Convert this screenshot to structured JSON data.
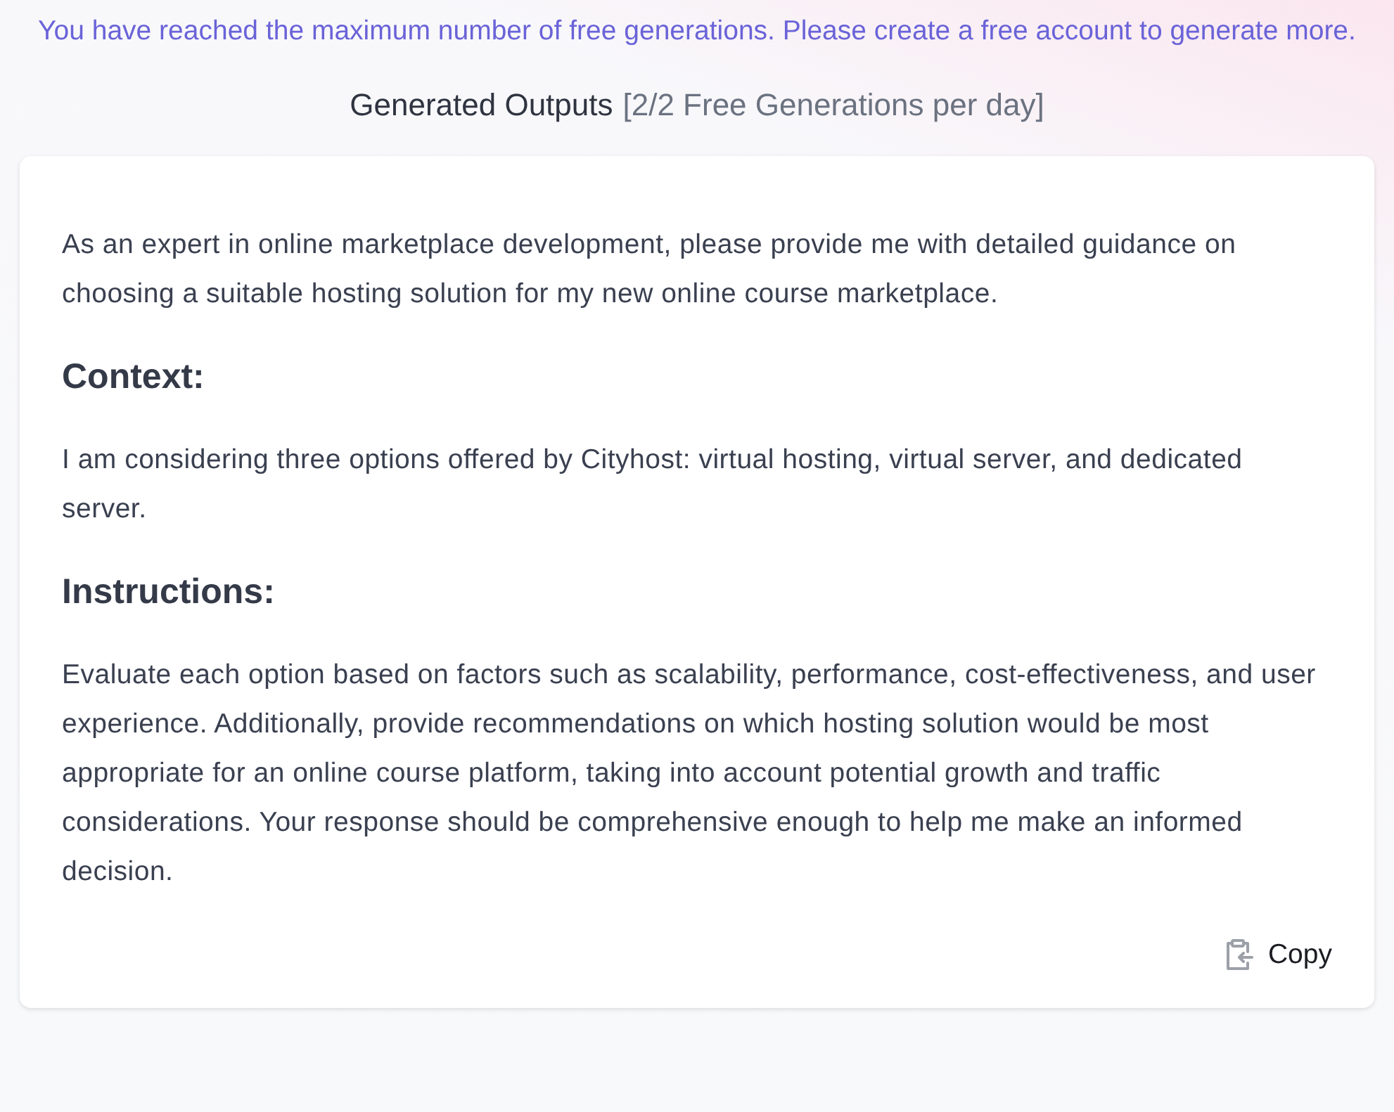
{
  "notice": "You have reached the maximum number of free generations. Please create a free account to generate more.",
  "header": {
    "title": "Generated Outputs",
    "quota": "[2/2 Free Generations per day]"
  },
  "output": {
    "blocks": [
      {
        "kind": "paragraph",
        "text": "As an expert in online marketplace development, please provide me with detailed guidance on choosing a suitable hosting solution for my new online course marketplace."
      },
      {
        "kind": "heading",
        "text": "Context:"
      },
      {
        "kind": "paragraph",
        "text": "I am considering three options offered by Cityhost: virtual hosting, virtual server, and dedicated server."
      },
      {
        "kind": "heading",
        "text": "Instructions:"
      },
      {
        "kind": "paragraph",
        "text": "Evaluate each option based on factors such as scalability, performance, cost-effectiveness, and user experience. Additionally, provide recommendations on which hosting solution would be most appropriate for an online course platform, taking into account potential growth and traffic considerations. Your response should be comprehensive enough to help me make an informed decision."
      }
    ],
    "copy_button": "Copy"
  }
}
